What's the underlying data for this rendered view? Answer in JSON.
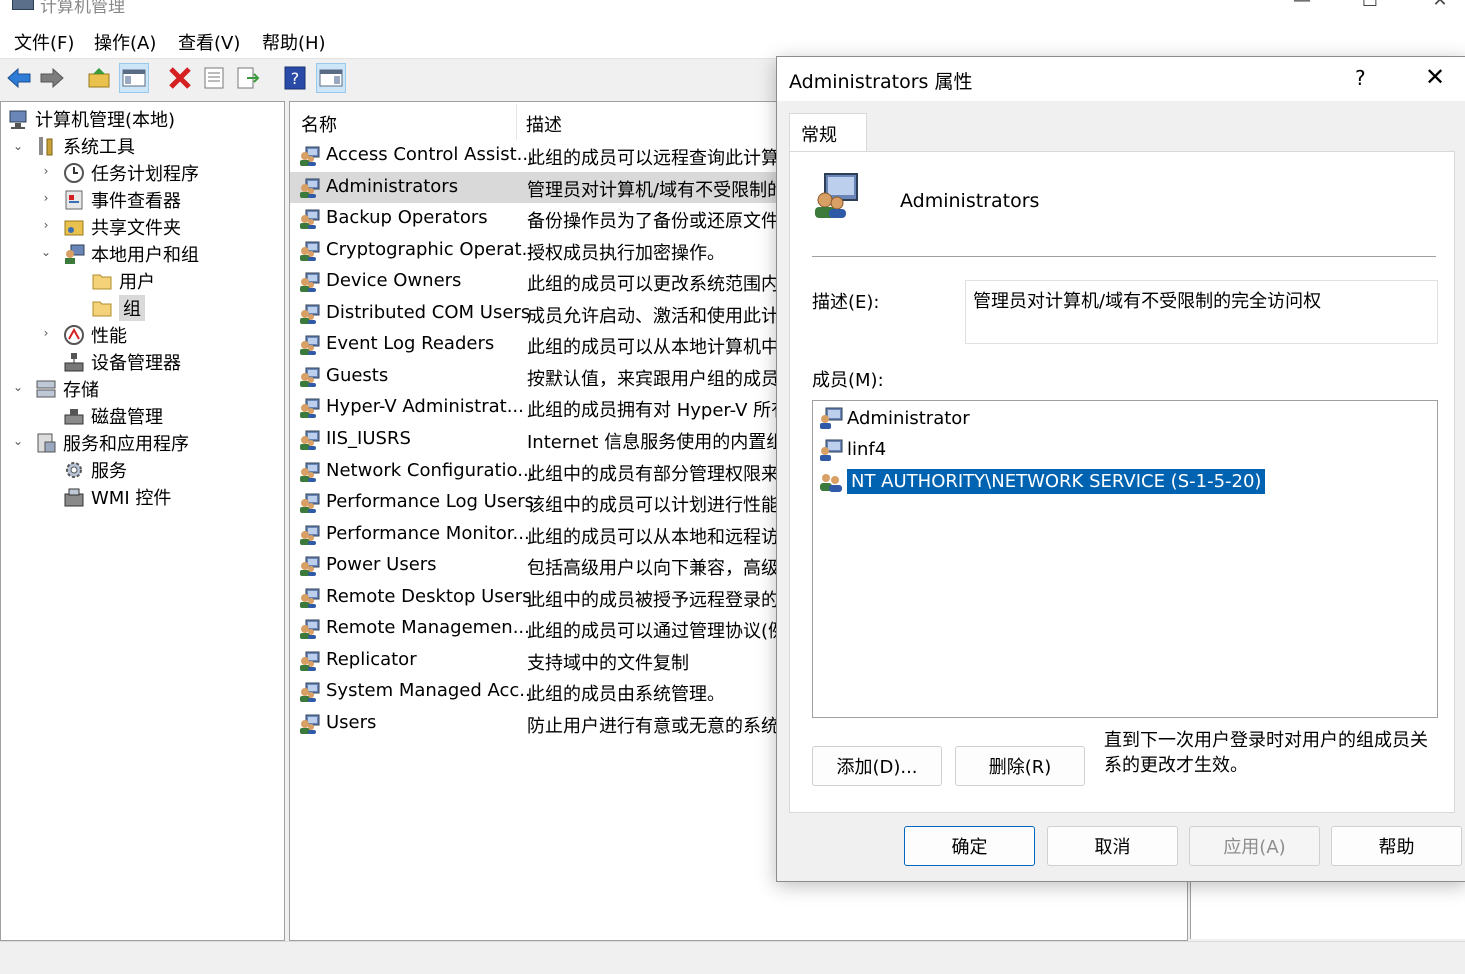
{
  "window": {
    "title": "计算机管理"
  },
  "menu": [
    "文件(F)",
    "操作(A)",
    "查看(V)",
    "帮助(H)"
  ],
  "toolbar": {
    "icons": [
      "back-arrow-icon",
      "forward-arrow-icon",
      "up-folder-icon",
      "show-hide-tree-icon",
      "delete-icon",
      "properties-icon",
      "export-list-icon",
      "help-icon",
      "show-hide-action-pane-icon"
    ]
  },
  "tree": {
    "root": "计算机管理(本地)",
    "system_tools": "系统工具",
    "task_scheduler": "任务计划程序",
    "event_viewer": "事件查看器",
    "shared_folders": "共享文件夹",
    "local_users_groups": "本地用户和组",
    "users": "用户",
    "groups": "组",
    "performance": "性能",
    "device_manager": "设备管理器",
    "storage": "存储",
    "disk_management": "磁盘管理",
    "services_apps": "服务和应用程序",
    "services": "服务",
    "wmi": "WMI 控件"
  },
  "list": {
    "col_name": "名称",
    "col_desc": "描述",
    "rows": [
      {
        "name": "Access Control Assist...",
        "desc": "此组的成员可以远程查询此计算"
      },
      {
        "name": "Administrators",
        "desc": "管理员对计算机/域有不受限制的"
      },
      {
        "name": "Backup Operators",
        "desc": "备份操作员为了备份或还原文件"
      },
      {
        "name": "Cryptographic Operat...",
        "desc": "授权成员执行加密操作。"
      },
      {
        "name": "Device Owners",
        "desc": "此组的成员可以更改系统范围内"
      },
      {
        "name": "Distributed COM Users",
        "desc": "成员允许启动、激活和使用此计"
      },
      {
        "name": "Event Log Readers",
        "desc": "此组的成员可以从本地计算机中"
      },
      {
        "name": "Guests",
        "desc": "按默认值，来宾跟用户组的成员"
      },
      {
        "name": "Hyper-V Administrat...",
        "desc": "此组的成员拥有对 Hyper-V 所有"
      },
      {
        "name": "IIS_IUSRS",
        "desc": "Internet 信息服务使用的内置组"
      },
      {
        "name": "Network Configuratio...",
        "desc": "此组中的成员有部分管理权限来"
      },
      {
        "name": "Performance Log Users",
        "desc": "该组中的成员可以计划进行性能"
      },
      {
        "name": "Performance Monitor...",
        "desc": "此组的成员可以从本地和远程访"
      },
      {
        "name": "Power Users",
        "desc": "包括高级用户以向下兼容，高级"
      },
      {
        "name": "Remote Desktop Users",
        "desc": "此组中的成员被授予远程登录的"
      },
      {
        "name": "Remote Managemen...",
        "desc": "此组的成员可以通过管理协议(例"
      },
      {
        "name": "Replicator",
        "desc": "支持域中的文件复制"
      },
      {
        "name": "System Managed Acc...",
        "desc": "此组的成员由系统管理。"
      },
      {
        "name": "Users",
        "desc": "防止用户进行有意或无意的系统"
      }
    ]
  },
  "dialog": {
    "title": "Administrators 属性",
    "help_glyph": "?",
    "close_glyph": "✕",
    "tab": "常规",
    "group_name": "Administrators",
    "desc_label": "描述(E):",
    "desc_value": "管理员对计算机/域有不受限制的完全访问权",
    "members_label": "成员(M):",
    "members": [
      {
        "name": "Administrator",
        "icon": "user-icon"
      },
      {
        "name": "linf4",
        "icon": "user-icon"
      },
      {
        "name": "NT AUTHORITY\\NETWORK SERVICE (S-1-5-20)",
        "icon": "group-icon"
      }
    ],
    "add_button": "添加(D)...",
    "remove_button": "删除(R)",
    "note": "直到下一次用户登录时对用户的组成员关系的更改才生效。",
    "ok_button": "确定",
    "cancel_button": "取消",
    "apply_button": "应用(A)",
    "help_button": "帮助"
  }
}
